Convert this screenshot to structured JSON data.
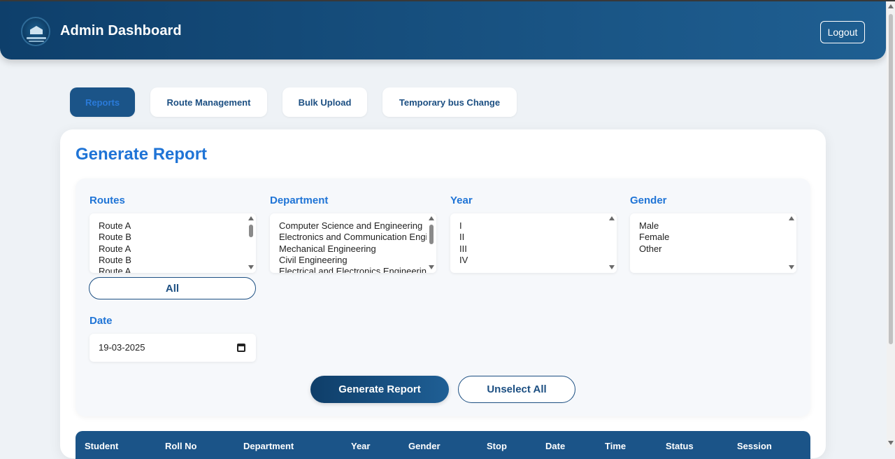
{
  "header": {
    "title": "Admin Dashboard",
    "logout_label": "Logout"
  },
  "tabs": [
    {
      "label": "Reports",
      "active": true
    },
    {
      "label": "Route Management",
      "active": false
    },
    {
      "label": "Bulk Upload",
      "active": false
    },
    {
      "label": "Temporary bus Change",
      "active": false
    }
  ],
  "report": {
    "title": "Generate Report",
    "routes": {
      "label": "Routes",
      "options": [
        "Route A",
        "Route B",
        "Route A",
        "Route B",
        "Route A"
      ],
      "all_label": "All"
    },
    "department": {
      "label": "Department",
      "options": [
        "Computer Science and Engineering",
        "Electronics and Communication Engineering",
        "Mechanical Engineering",
        "Civil Engineering",
        "Electrical and Electronics Engineering"
      ]
    },
    "year": {
      "label": "Year",
      "options": [
        "I",
        "II",
        "III",
        "IV"
      ]
    },
    "gender": {
      "label": "Gender",
      "options": [
        "Male",
        "Female",
        "Other"
      ]
    },
    "date": {
      "label": "Date",
      "value": "19-03-2025"
    },
    "generate_label": "Generate Report",
    "unselect_label": "Unselect All"
  },
  "table": {
    "columns": [
      "Student",
      "Roll No",
      "Department",
      "Year",
      "Gender",
      "Stop",
      "Date",
      "Time",
      "Status",
      "Session"
    ]
  },
  "colors": {
    "header_gradient_start": "#0e3f6b",
    "header_gradient_end": "#1f5f92",
    "accent_blue": "#1f74d6",
    "button_navy": "#1c4f82",
    "page_bg": "#eef2f6"
  },
  "icons": [
    "logo-icon",
    "calendar-icon",
    "scroll-up-icon",
    "scroll-down-icon"
  ]
}
